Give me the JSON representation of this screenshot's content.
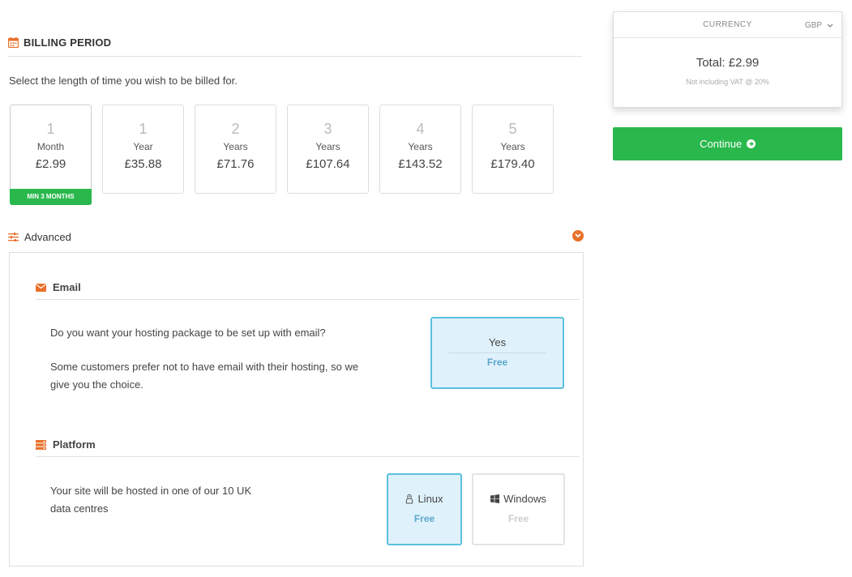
{
  "billing": {
    "title": "BILLING PERIOD",
    "lead": "Select the length of time you wish to be billed for.",
    "periods": [
      {
        "num": "1",
        "unit": "Month",
        "price": "£2.99",
        "tag": "MIN 3 MONTHS"
      },
      {
        "num": "1",
        "unit": "Year",
        "price": "£35.88"
      },
      {
        "num": "2",
        "unit": "Years",
        "price": "£71.76"
      },
      {
        "num": "3",
        "unit": "Years",
        "price": "£107.64"
      },
      {
        "num": "4",
        "unit": "Years",
        "price": "£143.52"
      },
      {
        "num": "5",
        "unit": "Years",
        "price": "£179.40"
      }
    ]
  },
  "advanced": {
    "title": "Advanced",
    "email": {
      "title": "Email",
      "question": "Do you want your hosting package to be set up with email?",
      "note_line1": "Some customers prefer not to have email with their hosting, so we",
      "note_line2": "give you the choice.",
      "option": {
        "label": "Yes",
        "fee": "Free"
      }
    },
    "platform": {
      "title": "Platform",
      "desc_line1": "Your site will be hosted in one of our 10 UK",
      "desc_line2": "data centres",
      "options": [
        {
          "label": "Linux",
          "fee": "Free"
        },
        {
          "label": "Windows",
          "fee": "Free"
        }
      ]
    }
  },
  "summary": {
    "currency_label": "CURRENCY",
    "currency_value": "GBP",
    "total": "Total: £2.99",
    "vat_note": "Not including VAT @ 20%"
  },
  "continue_label": "Continue",
  "colors": {
    "accent": "#e8702a",
    "green": "#2ab84d",
    "selected_border": "#5bc0de",
    "selected_bg": "#dff1fa"
  }
}
